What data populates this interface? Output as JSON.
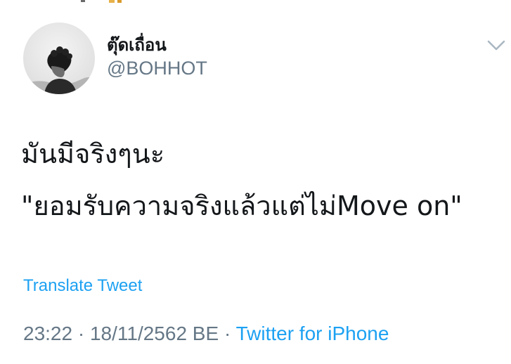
{
  "user": {
    "display_name": "ตุ๊ดเถื่อน",
    "handle": "@BOHHOT"
  },
  "tweet": {
    "lines": [
      "มันมีจริงๆนะ",
      "\"ยอมรับความจริงแล้วแต่ไม่Move on\""
    ],
    "translate_label": "Translate Tweet"
  },
  "meta": {
    "time": "23:22",
    "separator": "·",
    "date": "18/11/2562 BE",
    "source": "Twitter for iPhone"
  },
  "icons": {
    "menu": "chevron-down-icon",
    "avatar": "avatar"
  },
  "colors": {
    "link": "#1da1f2",
    "secondary_text": "#657786",
    "primary_text": "#14171a",
    "caret": "#aab8c2"
  }
}
